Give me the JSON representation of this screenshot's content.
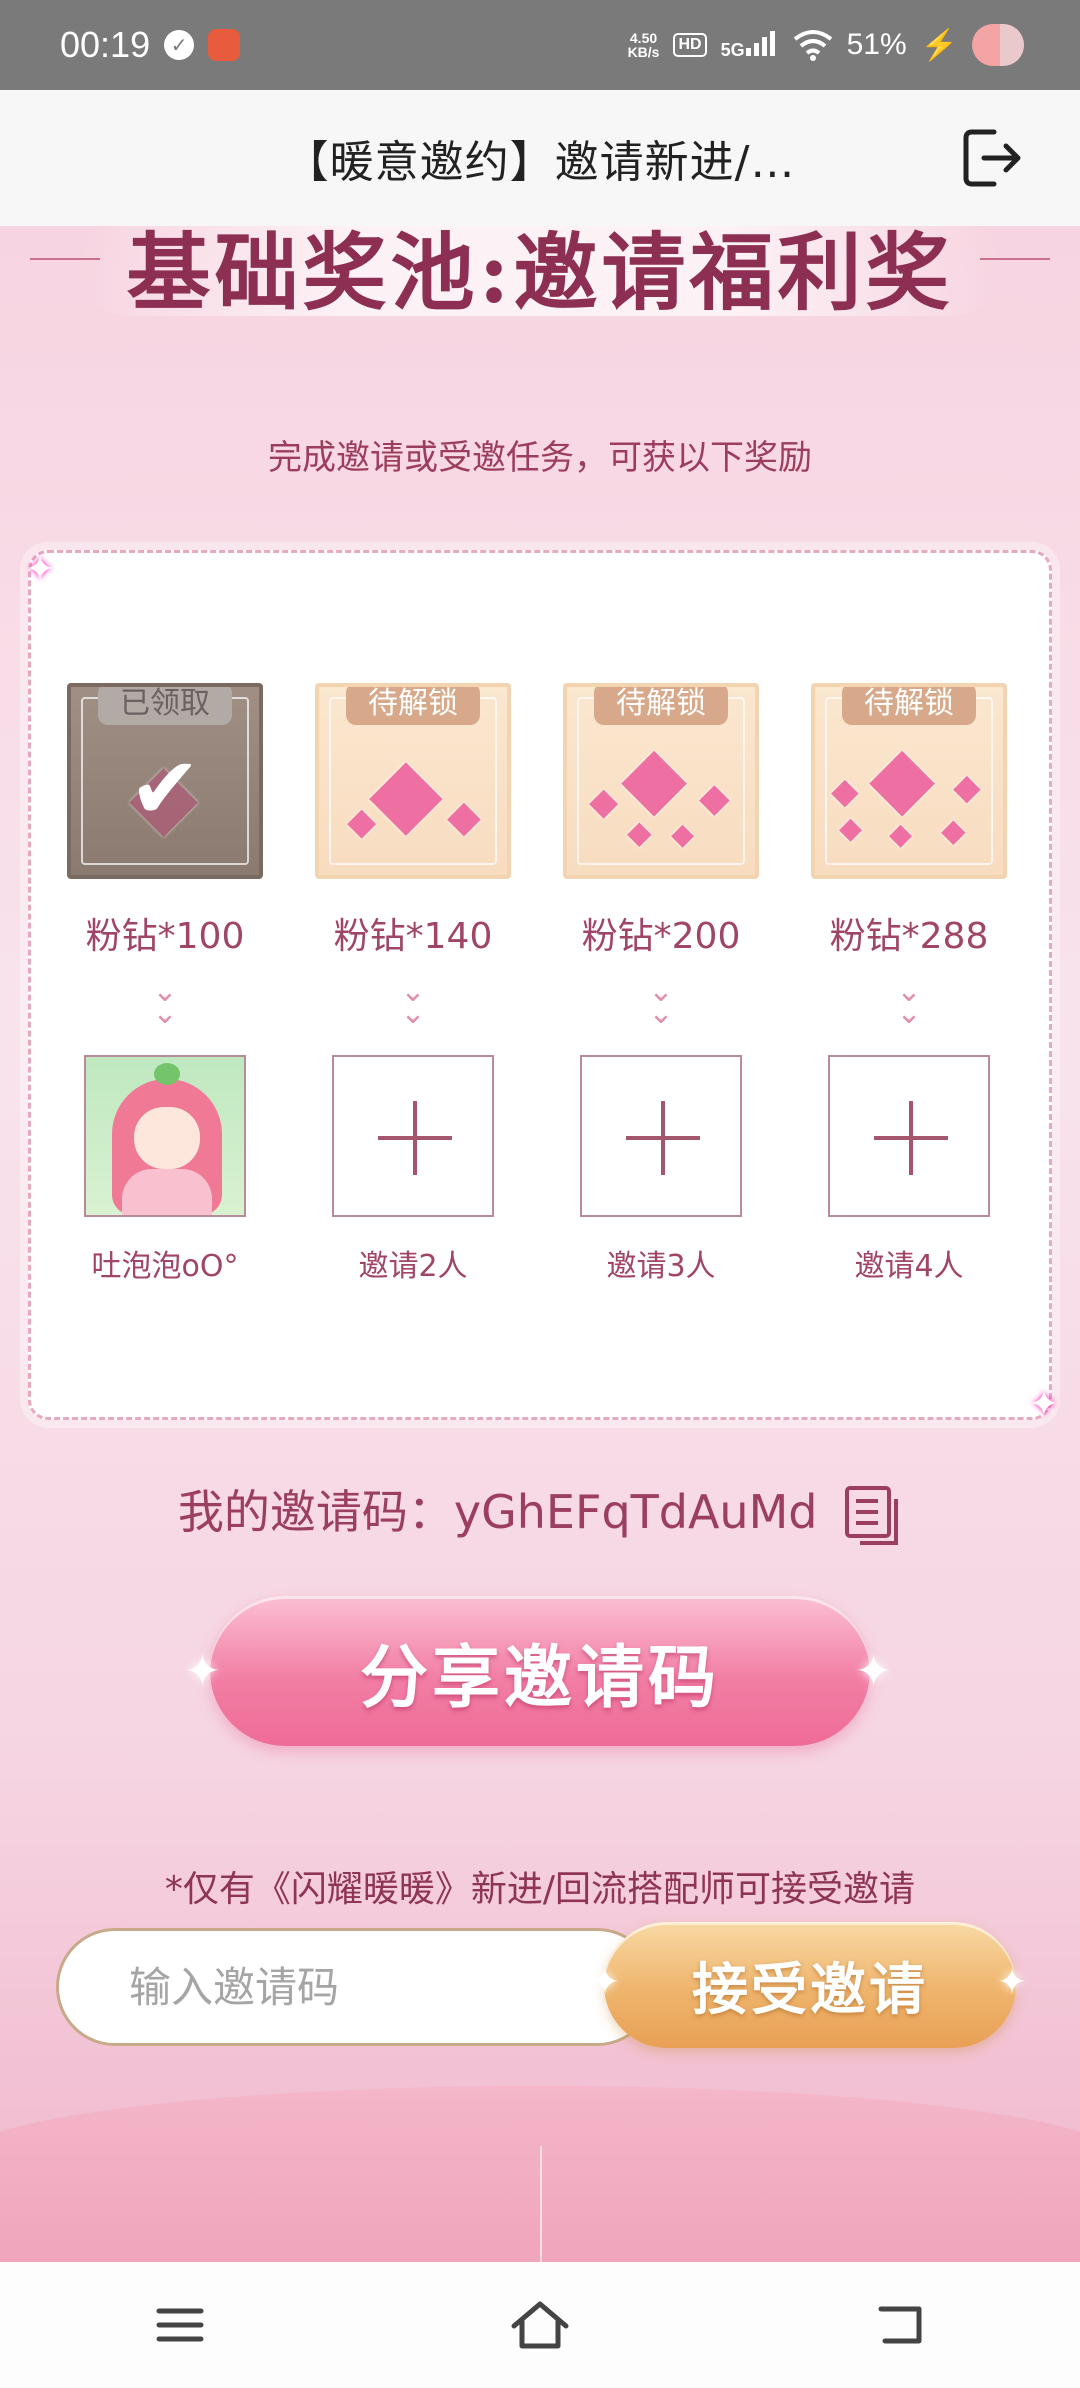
{
  "status_bar": {
    "time": "00:19",
    "net_speed_value": "4.50",
    "net_speed_unit": "KB/s",
    "hd": "HD",
    "network": "5G",
    "battery": "51%"
  },
  "header": {
    "title": "【暖意邀约】邀请新进/…"
  },
  "banner": {
    "title": "基础奖池:邀请福利奖"
  },
  "subtitle": "完成邀请或受邀任务，可获以下奖励",
  "rewards": [
    {
      "status": "已领取",
      "amount": "粉钻*100",
      "slot_label": "吐泡泡oO°",
      "claimed": true
    },
    {
      "status": "待解锁",
      "amount": "粉钻*140",
      "slot_label": "邀请2人",
      "claimed": false
    },
    {
      "status": "待解锁",
      "amount": "粉钻*200",
      "slot_label": "邀请3人",
      "claimed": false
    },
    {
      "status": "待解锁",
      "amount": "粉钻*288",
      "slot_label": "邀请4人",
      "claimed": false
    }
  ],
  "invite": {
    "label": "我的邀请码：",
    "code": "yGhEFqTdAuMd"
  },
  "share_button": "分享邀请码",
  "notice": "*仅有《闪耀暖暖》新进/回流搭配师可接受邀请",
  "accept": {
    "placeholder": "输入邀请码",
    "button": "接受邀请"
  },
  "colors": {
    "accent_pink": "#ee6c97",
    "accent_gold": "#efb46c",
    "text_rose": "#9b3e60"
  }
}
